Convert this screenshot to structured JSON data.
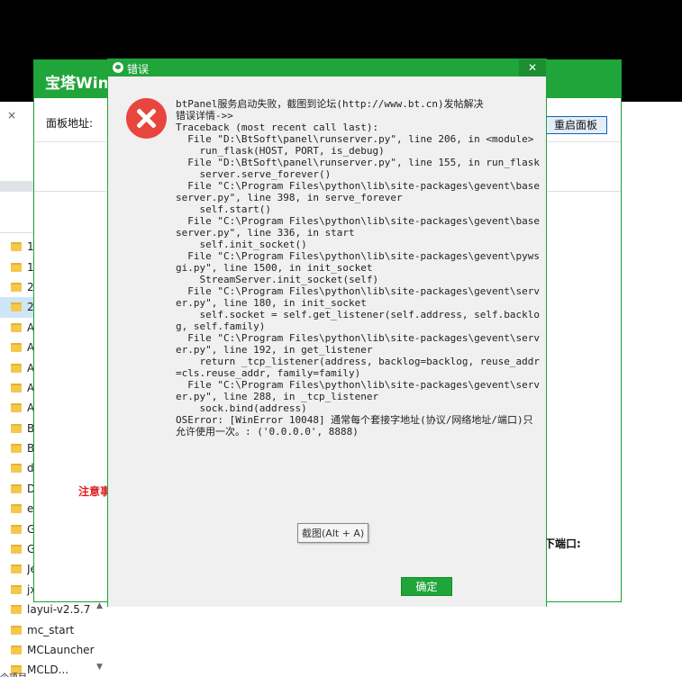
{
  "colors": {
    "accent": "#20a53a",
    "error": "#e8463d",
    "notice": "#e02020"
  },
  "explorer": {
    "close_glyph": "×",
    "folders": [
      {
        "label": "1"
      },
      {
        "label": "1"
      },
      {
        "label": "2"
      },
      {
        "label": "2",
        "selected": true
      },
      {
        "label": "A"
      },
      {
        "label": "A"
      },
      {
        "label": "A"
      },
      {
        "label": "A"
      },
      {
        "label": "A"
      },
      {
        "label": "B"
      },
      {
        "label": "B"
      },
      {
        "label": "d"
      },
      {
        "label": "D"
      },
      {
        "label": "e"
      },
      {
        "label": "G"
      },
      {
        "label": "G"
      },
      {
        "label": "Je"
      },
      {
        "label": "jx"
      },
      {
        "label": "layui-v2.5.7"
      },
      {
        "label": "mc_start"
      },
      {
        "label": "MCLauncher"
      },
      {
        "label": "MCLD..."
      }
    ],
    "status": "个项目"
  },
  "bt_window": {
    "title": "宝塔Windo",
    "panel_address_label": "面板地址:",
    "restart_label": "重启面板",
    "notice_label": "注意事",
    "port_label": "下端口:",
    "minimize_glyph": "—",
    "maximize_glyph": "☐",
    "close_glyph": "✕"
  },
  "dialog": {
    "title": "错误",
    "close_glyph": "✕",
    "icon": "error-icon",
    "message": "btPanel服务启动失败，截图到论坛(http://www.bt.cn)发帖解决\n错误详情->>\nTraceback (most recent call last):\n  File \"D:\\BtSoft\\panel\\runserver.py\", line 206, in <module>\n    run_flask(HOST, PORT, is_debug)\n  File \"D:\\BtSoft\\panel\\runserver.py\", line 155, in run_flask\n    server.serve_forever()\n  File \"C:\\Program Files\\python\\lib\\site-packages\\gevent\\baseserver.py\", line 398, in serve_forever\n    self.start()\n  File \"C:\\Program Files\\python\\lib\\site-packages\\gevent\\baseserver.py\", line 336, in start\n    self.init_socket()\n  File \"C:\\Program Files\\python\\lib\\site-packages\\gevent\\pywsgi.py\", line 1500, in init_socket\n    StreamServer.init_socket(self)\n  File \"C:\\Program Files\\python\\lib\\site-packages\\gevent\\server.py\", line 180, in init_socket\n    self.socket = self.get_listener(self.address, self.backlog, self.family)\n  File \"C:\\Program Files\\python\\lib\\site-packages\\gevent\\server.py\", line 192, in get_listener\n    return _tcp_listener(address, backlog=backlog, reuse_addr=cls.reuse_addr, family=family)\n  File \"C:\\Program Files\\python\\lib\\site-packages\\gevent\\server.py\", line 288, in _tcp_listener\n    sock.bind(address)\nOSError: [WinError 10048] 通常每个套接字地址(协议/网络地址/端口)只允许使用一次。: ('0.0.0.0', 8888)",
    "ok_label": "确定"
  },
  "tooltip": {
    "text": "截图(Alt + A)"
  }
}
